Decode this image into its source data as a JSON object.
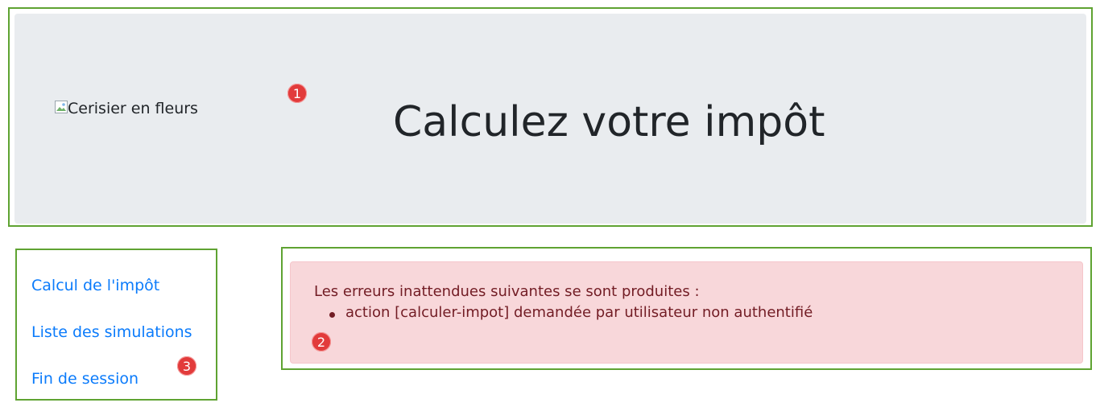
{
  "header": {
    "image_alt": "Cerisier en fleurs",
    "title": "Calculez votre impôt"
  },
  "menu": {
    "items": [
      {
        "label": "Calcul de l'impôt"
      },
      {
        "label": "Liste des simulations"
      },
      {
        "label": "Fin de session"
      }
    ]
  },
  "alert": {
    "intro": "Les erreurs inattendues suivantes se sont produites :",
    "errors": [
      "action [calculer-impot] demandée par utilisateur non authentifié"
    ]
  },
  "annotations": {
    "badge_1": "1",
    "badge_2": "2",
    "badge_3": "3"
  },
  "colors": {
    "frame": "#5fa332",
    "jumbotron": "#e9ecef",
    "link": "#0b7bfb",
    "alert_bg": "#f8d7da",
    "alert_text": "#721c24",
    "badge": "#e23b3b"
  }
}
